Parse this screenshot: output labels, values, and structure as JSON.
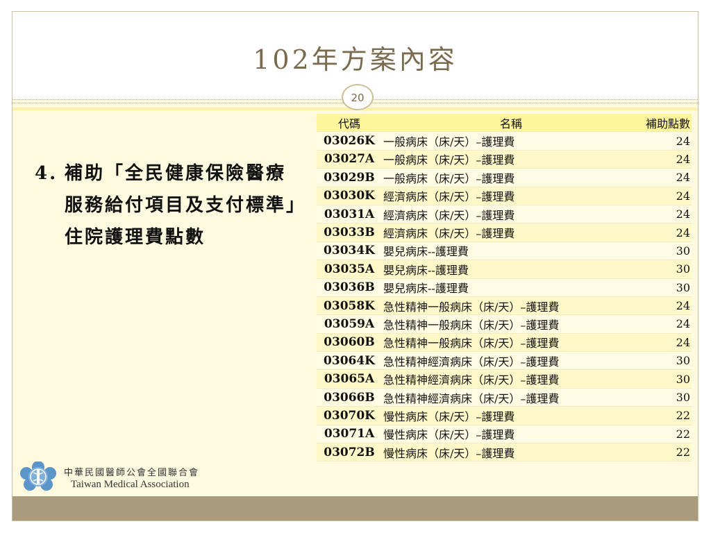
{
  "slide": {
    "title": "102年方案內容",
    "page_number": "20"
  },
  "bullet": {
    "number": "4.",
    "text": "補助「全民健康保險醫療服務給付項目及支付標準」住院護理費點數"
  },
  "table": {
    "headers": {
      "code": "代碼",
      "name": "名稱",
      "points": "補助點數"
    },
    "rows": [
      {
        "code": "03026K",
        "name": "一般病床（床/天）–護理費",
        "points": "24"
      },
      {
        "code": "03027A",
        "name": "一般病床（床/天）–護理費",
        "points": "24"
      },
      {
        "code": "03029B",
        "name": "一般病床（床/天）–護理費",
        "points": "24"
      },
      {
        "code": "03030K",
        "name": "經濟病床（床/天）–護理費",
        "points": "24"
      },
      {
        "code": "03031A",
        "name": "經濟病床（床/天）–護理費",
        "points": "24"
      },
      {
        "code": "03033B",
        "name": "經濟病床（床/天）–護理費",
        "points": "24"
      },
      {
        "code": "03034K",
        "name": "嬰兒病床--護理費",
        "points": "30"
      },
      {
        "code": "03035A",
        "name": "嬰兒病床--護理費",
        "points": "30"
      },
      {
        "code": "03036B",
        "name": "嬰兒病床--護理費",
        "points": "30"
      },
      {
        "code": "03058K",
        "name": "急性精神一般病床（床/天）–護理費",
        "points": "24"
      },
      {
        "code": "03059A",
        "name": "急性精神一般病床（床/天）–護理費",
        "points": "24"
      },
      {
        "code": "03060B",
        "name": "急性精神一般病床（床/天）–護理費",
        "points": "24"
      },
      {
        "code": "03064K",
        "name": "急性精神經濟病床（床/天）–護理費",
        "points": "30"
      },
      {
        "code": "03065A",
        "name": "急性精神經濟病床（床/天）–護理費",
        "points": "30"
      },
      {
        "code": "03066B",
        "name": "急性精神經濟病床（床/天）–護理費",
        "points": "30"
      },
      {
        "code": "03070K",
        "name": "慢性病床（床/天）–護理費",
        "points": "22"
      },
      {
        "code": "03071A",
        "name": "慢性病床（床/天）–護理費",
        "points": "22"
      },
      {
        "code": "03072B",
        "name": "慢性病床（床/天）–護理費",
        "points": "22"
      }
    ]
  },
  "footer": {
    "org_name_zh": "中華民國醫師公會全國聯合會",
    "org_name_en": "Taiwan Medical Association",
    "logo_icon": "tma-logo-icon"
  },
  "colors": {
    "title": "#7a6a4e",
    "slide_bg": "#fdfae0",
    "header_row": "#fff59a",
    "footer_bar": "#a99b7b"
  }
}
